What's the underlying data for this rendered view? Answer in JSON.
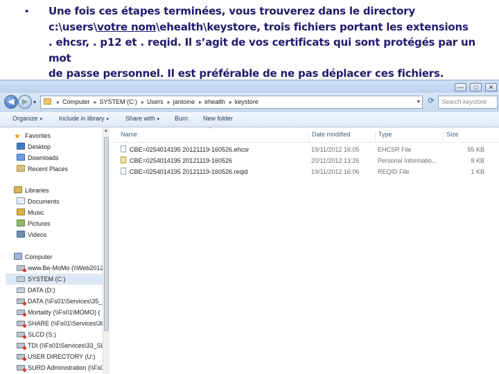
{
  "slide": {
    "bullet": "•",
    "text_line1": "Une fois ces étapes terminées, vous trouverez dans le directory",
    "text_line2_pre": "c:\\users\\",
    "text_line2_ul": "votre nom",
    "text_line2_post": "\\ehealth\\keystore, trois fichiers portant les extensions",
    "text_line3": ". ehcsr, . p12 et . reqid. Il s’agit de vos certificats qui sont protégés par un mot",
    "text_line4": "de passe personnel. Il est préférable de ne pas déplacer ces fichiers."
  },
  "window": {
    "buttons": {
      "minimize": "—",
      "maximize": "□",
      "close": "✕"
    },
    "address": {
      "crumbs": [
        "Computer",
        "SYSTEM (C:)",
        "Users",
        "jantoine",
        "ehealth",
        "keystore"
      ]
    },
    "search_placeholder": "Search keystore",
    "toolbar": {
      "organize": "Organize",
      "include": "Include in library",
      "share": "Share with",
      "burn": "Burn",
      "new_folder": "New folder"
    },
    "nav": {
      "favorites": "Favorites",
      "desktop": "Desktop",
      "downloads": "Downloads",
      "recent": "Recent Places",
      "libraries": "Libraries",
      "documents": "Documents",
      "music": "Music",
      "pictures": "Pictures",
      "videos": "Videos",
      "computer": "Computer",
      "drives": [
        "www.Be-MoMo (\\\\Web2012",
        "SYSTEM (C:)",
        "DATA (D:)",
        "DATA (\\\\Fs01\\Services\\35_",
        "Mortality (\\\\Fs01\\MOMO) (",
        "SHARE (\\\\Fs01\\Services\\30",
        "SLCD (S:)",
        "TDI (\\\\Fs01\\Services\\33_SL",
        "USER DIRECTORY (U:)",
        "SURD Administration (\\\\Fs0"
      ]
    },
    "columns": {
      "name": "Name",
      "date": "Date modified",
      "type": "Type",
      "size": "Size"
    },
    "files": [
      {
        "name": "CBE=0254014195 20121119-160526.ehcsr",
        "date": "19/11/2012 16:05",
        "type": "EHCSR File",
        "size": "55 KB"
      },
      {
        "name": "CBE=0254014195 20121119-160526",
        "date": "20/11/2012 13:26",
        "type": "Personal Informatio...",
        "size": "8 KB"
      },
      {
        "name": "CBE=0254014195 20121119-160526.reqid",
        "date": "19/11/2012 16:06",
        "type": "REQID File",
        "size": "1 KB"
      }
    ]
  }
}
